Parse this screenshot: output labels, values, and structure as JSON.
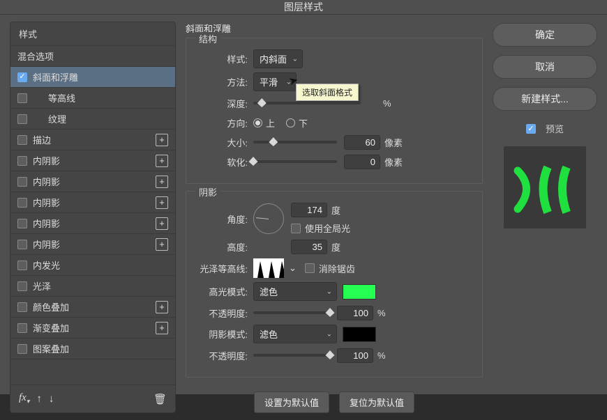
{
  "dialog": {
    "title": "图层样式"
  },
  "left": {
    "header": "样式",
    "blendingOptions": "混合选项",
    "items": [
      {
        "id": "bevel",
        "label": "斜面和浮雕",
        "checked": true,
        "selected": true,
        "addable": false,
        "indent": false
      },
      {
        "id": "contour",
        "label": "等高线",
        "checked": false,
        "selected": false,
        "addable": false,
        "indent": true
      },
      {
        "id": "texture",
        "label": "纹理",
        "checked": false,
        "selected": false,
        "addable": false,
        "indent": true
      },
      {
        "id": "stroke",
        "label": "描边",
        "checked": false,
        "selected": false,
        "addable": true,
        "indent": false
      },
      {
        "id": "ishadow1",
        "label": "内阴影",
        "checked": false,
        "selected": false,
        "addable": true,
        "indent": false
      },
      {
        "id": "ishadow2",
        "label": "内阴影",
        "checked": false,
        "selected": false,
        "addable": true,
        "indent": false
      },
      {
        "id": "ishadow3",
        "label": "内阴影",
        "checked": false,
        "selected": false,
        "addable": true,
        "indent": false
      },
      {
        "id": "ishadow4",
        "label": "内阴影",
        "checked": false,
        "selected": false,
        "addable": true,
        "indent": false
      },
      {
        "id": "ishadow5",
        "label": "内阴影",
        "checked": false,
        "selected": false,
        "addable": true,
        "indent": false
      },
      {
        "id": "iglow",
        "label": "内发光",
        "checked": false,
        "selected": false,
        "addable": false,
        "indent": false
      },
      {
        "id": "satin",
        "label": "光泽",
        "checked": false,
        "selected": false,
        "addable": false,
        "indent": false
      },
      {
        "id": "coverlay",
        "label": "颜色叠加",
        "checked": false,
        "selected": false,
        "addable": true,
        "indent": false
      },
      {
        "id": "goverlay",
        "label": "渐变叠加",
        "checked": false,
        "selected": false,
        "addable": true,
        "indent": false
      },
      {
        "id": "poverlay",
        "label": "图案叠加",
        "checked": false,
        "selected": false,
        "addable": false,
        "indent": false
      }
    ]
  },
  "mid": {
    "panelTitle": "斜面和浮雕",
    "structure": {
      "title": "结构",
      "styleLabel": "样式:",
      "styleValue": "内斜面",
      "techLabel": "方法:",
      "techValue": "平滑",
      "tooltip": "选取斜面格式",
      "depthLabel": "深度:",
      "depthUnit": "%",
      "directionLabel": "方向:",
      "dirUp": "上",
      "dirDown": "下",
      "sizeLabel": "大小:",
      "sizeValue": "60",
      "sizeUnit": "像素",
      "softenLabel": "软化:",
      "softenValue": "0",
      "softenUnit": "像素"
    },
    "shading": {
      "title": "阴影",
      "angleLabel": "角度:",
      "angleValue": "174",
      "angleUnit": "度",
      "globalLight": "使用全局光",
      "altitudeLabel": "高度:",
      "altitudeValue": "35",
      "altitudeUnit": "度",
      "glossContourLabel": "光泽等高线:",
      "antiAlias": "消除锯齿",
      "highlightModeLabel": "高光模式:",
      "highlightModeValue": "滤色",
      "highlightOpacityLabel": "不透明度:",
      "highlightOpacityValue": "100",
      "pct": "%",
      "shadowModeLabel": "阴影模式:",
      "shadowModeValue": "滤色",
      "shadowOpacityLabel": "不透明度:",
      "shadowOpacityValue": "100"
    },
    "buttons": {
      "setDefault": "设置为默认值",
      "resetDefault": "复位为默认值"
    }
  },
  "right": {
    "ok": "确定",
    "cancel": "取消",
    "newStyle": "新建样式...",
    "previewLabel": "预览"
  },
  "colors": {
    "highlight": "#25ff52",
    "shadow": "#000000"
  }
}
